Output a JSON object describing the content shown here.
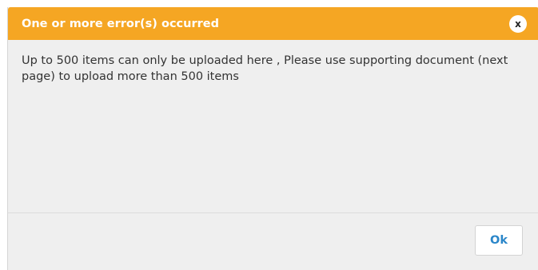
{
  "dialog": {
    "title": "One or more error(s) occurred",
    "close_label": "x",
    "message": "Up to 500 items can only be uploaded here , Please use supporting document (next page) to upload more than 500 items",
    "ok_label": "Ok"
  },
  "colors": {
    "header_background": "#f5a623",
    "body_background": "#efefef",
    "ok_text": "#2a86c9"
  },
  "icons": {
    "close": "close-icon"
  }
}
